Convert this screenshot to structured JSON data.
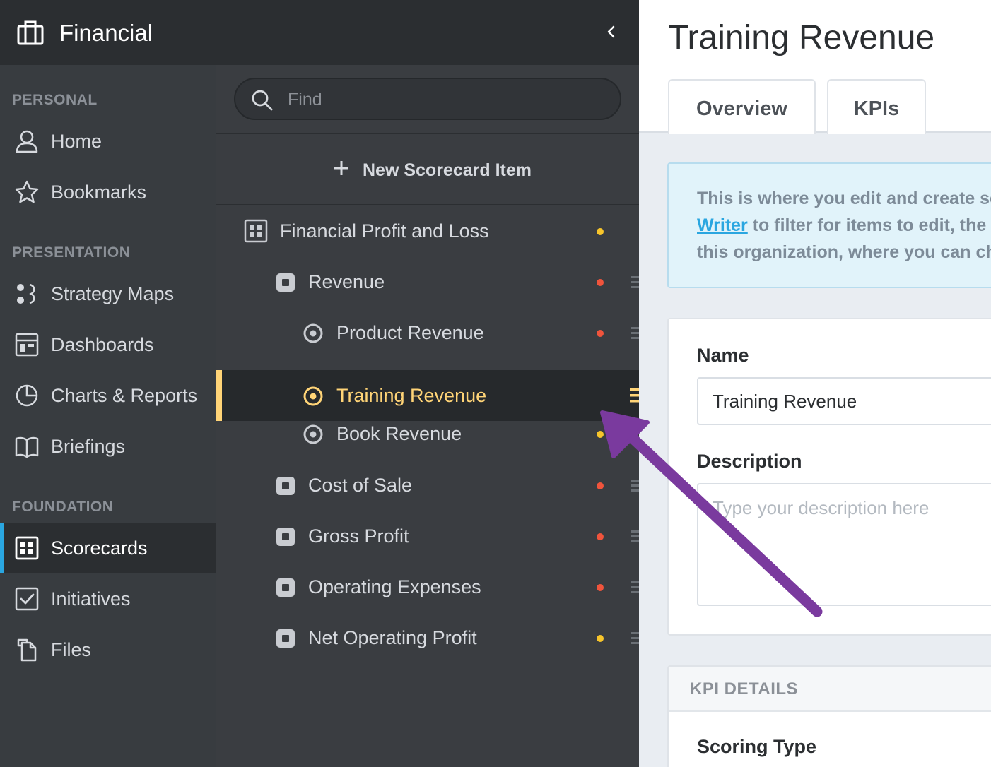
{
  "header": {
    "title": "Financial"
  },
  "sidenav": {
    "sections": [
      {
        "label": "PERSONAL"
      },
      {
        "label": "PRESENTATION"
      },
      {
        "label": "FOUNDATION"
      }
    ],
    "items": [
      {
        "label": "Home",
        "icon": "user-icon"
      },
      {
        "label": "Bookmarks",
        "icon": "star-icon"
      },
      {
        "label": "Strategy Maps",
        "icon": "strategy-map-icon"
      },
      {
        "label": "Dashboards",
        "icon": "dashboard-icon"
      },
      {
        "label": "Charts & Reports",
        "icon": "pie-chart-icon"
      },
      {
        "label": "Briefings",
        "icon": "book-icon"
      },
      {
        "label": "Scorecards",
        "icon": "scorecard-icon",
        "active": true
      },
      {
        "label": "Initiatives",
        "icon": "checkbox-icon"
      },
      {
        "label": "Files",
        "icon": "files-icon"
      }
    ]
  },
  "tree": {
    "search_placeholder": "Find",
    "new_item_label": "New Scorecard Item",
    "items": [
      {
        "label": "Financial Profit and Loss",
        "status": "yellow"
      },
      {
        "label": "Revenue",
        "status": "red"
      },
      {
        "label": "Product Revenue",
        "status": "red"
      },
      {
        "label": "Training Revenue",
        "selected": true
      },
      {
        "label": "Book Revenue",
        "status": "yellow"
      },
      {
        "label": "Cost of Sale",
        "status": "red"
      },
      {
        "label": "Gross Profit",
        "status": "red"
      },
      {
        "label": "Operating Expenses",
        "status": "red"
      },
      {
        "label": "Net Operating Profit",
        "status": "yellow"
      }
    ]
  },
  "main": {
    "title": "Training Revenue",
    "tabs": [
      {
        "label": "Overview"
      },
      {
        "label": "KPIs"
      }
    ],
    "info": {
      "line1": "This is where you edit and create sc",
      "link": "Writer",
      "line2_rest": " to filter for items to edit, the",
      "line3": "this organization, where you can ch"
    },
    "form": {
      "name_label": "Name",
      "name_value": "Training Revenue",
      "description_label": "Description",
      "description_placeholder": "Type your description here"
    },
    "kpi_details": {
      "header": "KPI DETAILS",
      "scoring_type_label": "Scoring Type"
    }
  },
  "colors": {
    "accent": "#2aa6e0",
    "selected": "#ffd477",
    "status_red": "#f0543c",
    "status_yellow": "#f7c52b",
    "annotation_arrow": "#7a3a9e"
  }
}
